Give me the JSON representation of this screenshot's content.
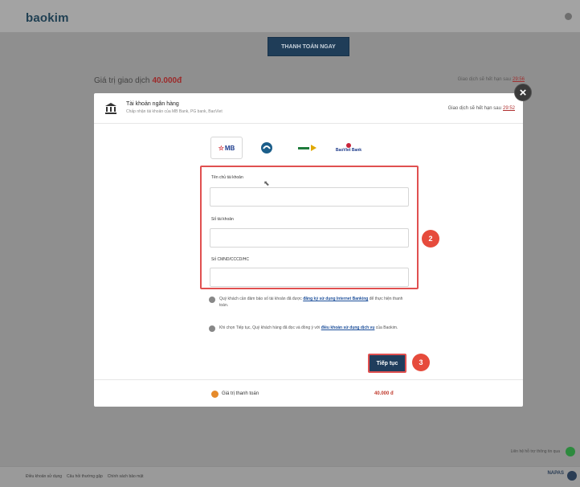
{
  "app": {
    "brand": "baokim"
  },
  "background": {
    "pay_button": "THANH TOÁN NGAY",
    "transaction_label": "Giá trị giao dịch",
    "transaction_amount": "40.000đ",
    "expiry_label": "Giao dịch sẽ hết hạn sau",
    "expiry_time": "29:56",
    "support_text": "Liên hệ hỗ trợ thông tin qua",
    "footer_links": [
      "Điều khoản sử dụng",
      "Câu hỏi thường gặp",
      "Chính sách bảo mật"
    ],
    "footer_badge": "NAPAS"
  },
  "modal": {
    "title": "Tài khoản ngân hàng",
    "subtitle": "Chấp nhận tài khoản của MB Bank, PG bank, BaoViet",
    "expiry_label": "Giao dịch sẽ hết hạn sau",
    "expiry_time": "29:52",
    "close_label": "×",
    "banks": [
      {
        "name": "MB",
        "selected": true
      },
      {
        "name": "BIDV"
      },
      {
        "name": "VPBank"
      },
      {
        "name": "BaoViet Bank"
      }
    ],
    "fields": {
      "account_holder": {
        "label": "Tên chủ tài khoản",
        "value": "",
        "placeholder": ""
      },
      "account_number": {
        "label": "Số tài khoản",
        "value": "",
        "placeholder": ""
      },
      "id_number": {
        "label": "Số CMND/CCCD/HC",
        "value": "",
        "placeholder": ""
      }
    },
    "step_2": "2",
    "step_3": "3",
    "notes": {
      "note_1_text": "Quý khách cần đảm bảo số tài khoản đã được",
      "note_1_link": "đăng ký sử dụng Internet Banking",
      "note_1_tail": "để thực hiện thanh toán.",
      "note_2_text": "Khi chọn Tiếp tục, Quý khách hàng đã đọc và đồng ý với",
      "note_2_link": "điều khoản sử dụng dịch vụ",
      "note_2_tail": "của Baokim."
    },
    "continue_label": "Tiếp tục",
    "payment_label": "Giá trị thanh toán",
    "payment_amount": "40.000 đ"
  },
  "colors": {
    "primary": "#1f3d5c",
    "accent_red": "#e05050",
    "step_red": "#e64b3c"
  }
}
